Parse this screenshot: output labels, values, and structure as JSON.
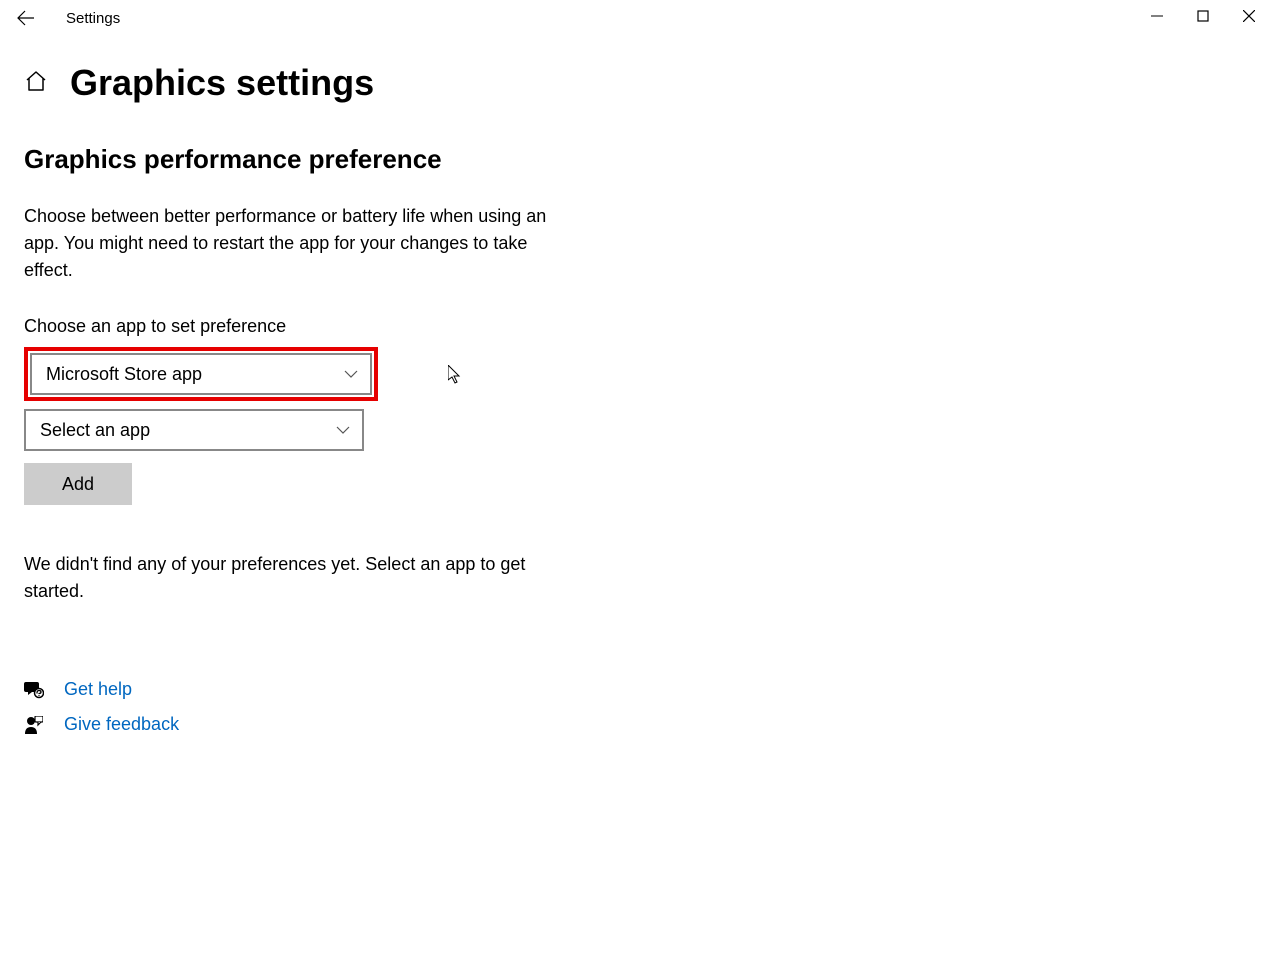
{
  "titlebar": {
    "title": "Settings"
  },
  "page": {
    "title": "Graphics settings",
    "section_title": "Graphics performance preference",
    "description": "Choose between better performance or battery life when using an app. You might need to restart the app for your changes to take effect.",
    "choose_label": "Choose an app to set preference",
    "dropdown1_value": "Microsoft Store app",
    "dropdown2_value": "Select an app",
    "add_button": "Add",
    "empty_message": "We didn't find any of your preferences yet. Select an app to get started.",
    "get_help": "Get help",
    "give_feedback": "Give feedback"
  }
}
